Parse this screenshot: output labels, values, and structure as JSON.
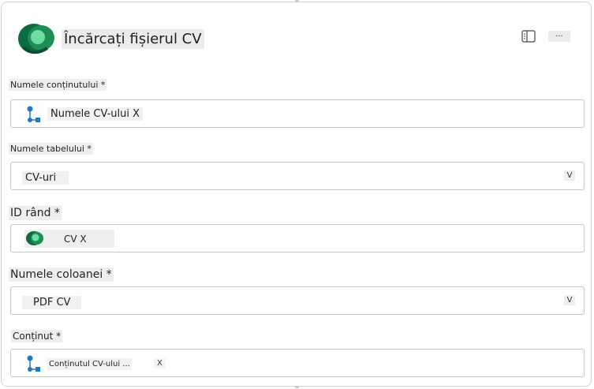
{
  "header": {
    "title": "Încărcați fișierul CV",
    "more_label": "..."
  },
  "fields": {
    "content_name": {
      "label": "Numele conținutului *",
      "value": "Numele CV-ului X"
    },
    "table_name": {
      "label": "Numele tabelului *",
      "value": "CV-uri",
      "chevron": "V"
    },
    "row_id": {
      "label": "ID rând *",
      "value": "CV X"
    },
    "column_name": {
      "label": "Numele coloanei *",
      "value": "PDF CV",
      "chevron": "V"
    },
    "content": {
      "label": "Conținut *",
      "value": "Conținutul CV-ului ...",
      "remove": "X"
    }
  },
  "colors": {
    "brand_dark": "#0b5a3a",
    "brand_light": "#5fd39a",
    "flow_blue": "#1f77c8"
  },
  "icons": [
    "dataverse-logo-icon",
    "panel-icon",
    "flow-token-icon",
    "dataverse-token-icon"
  ]
}
